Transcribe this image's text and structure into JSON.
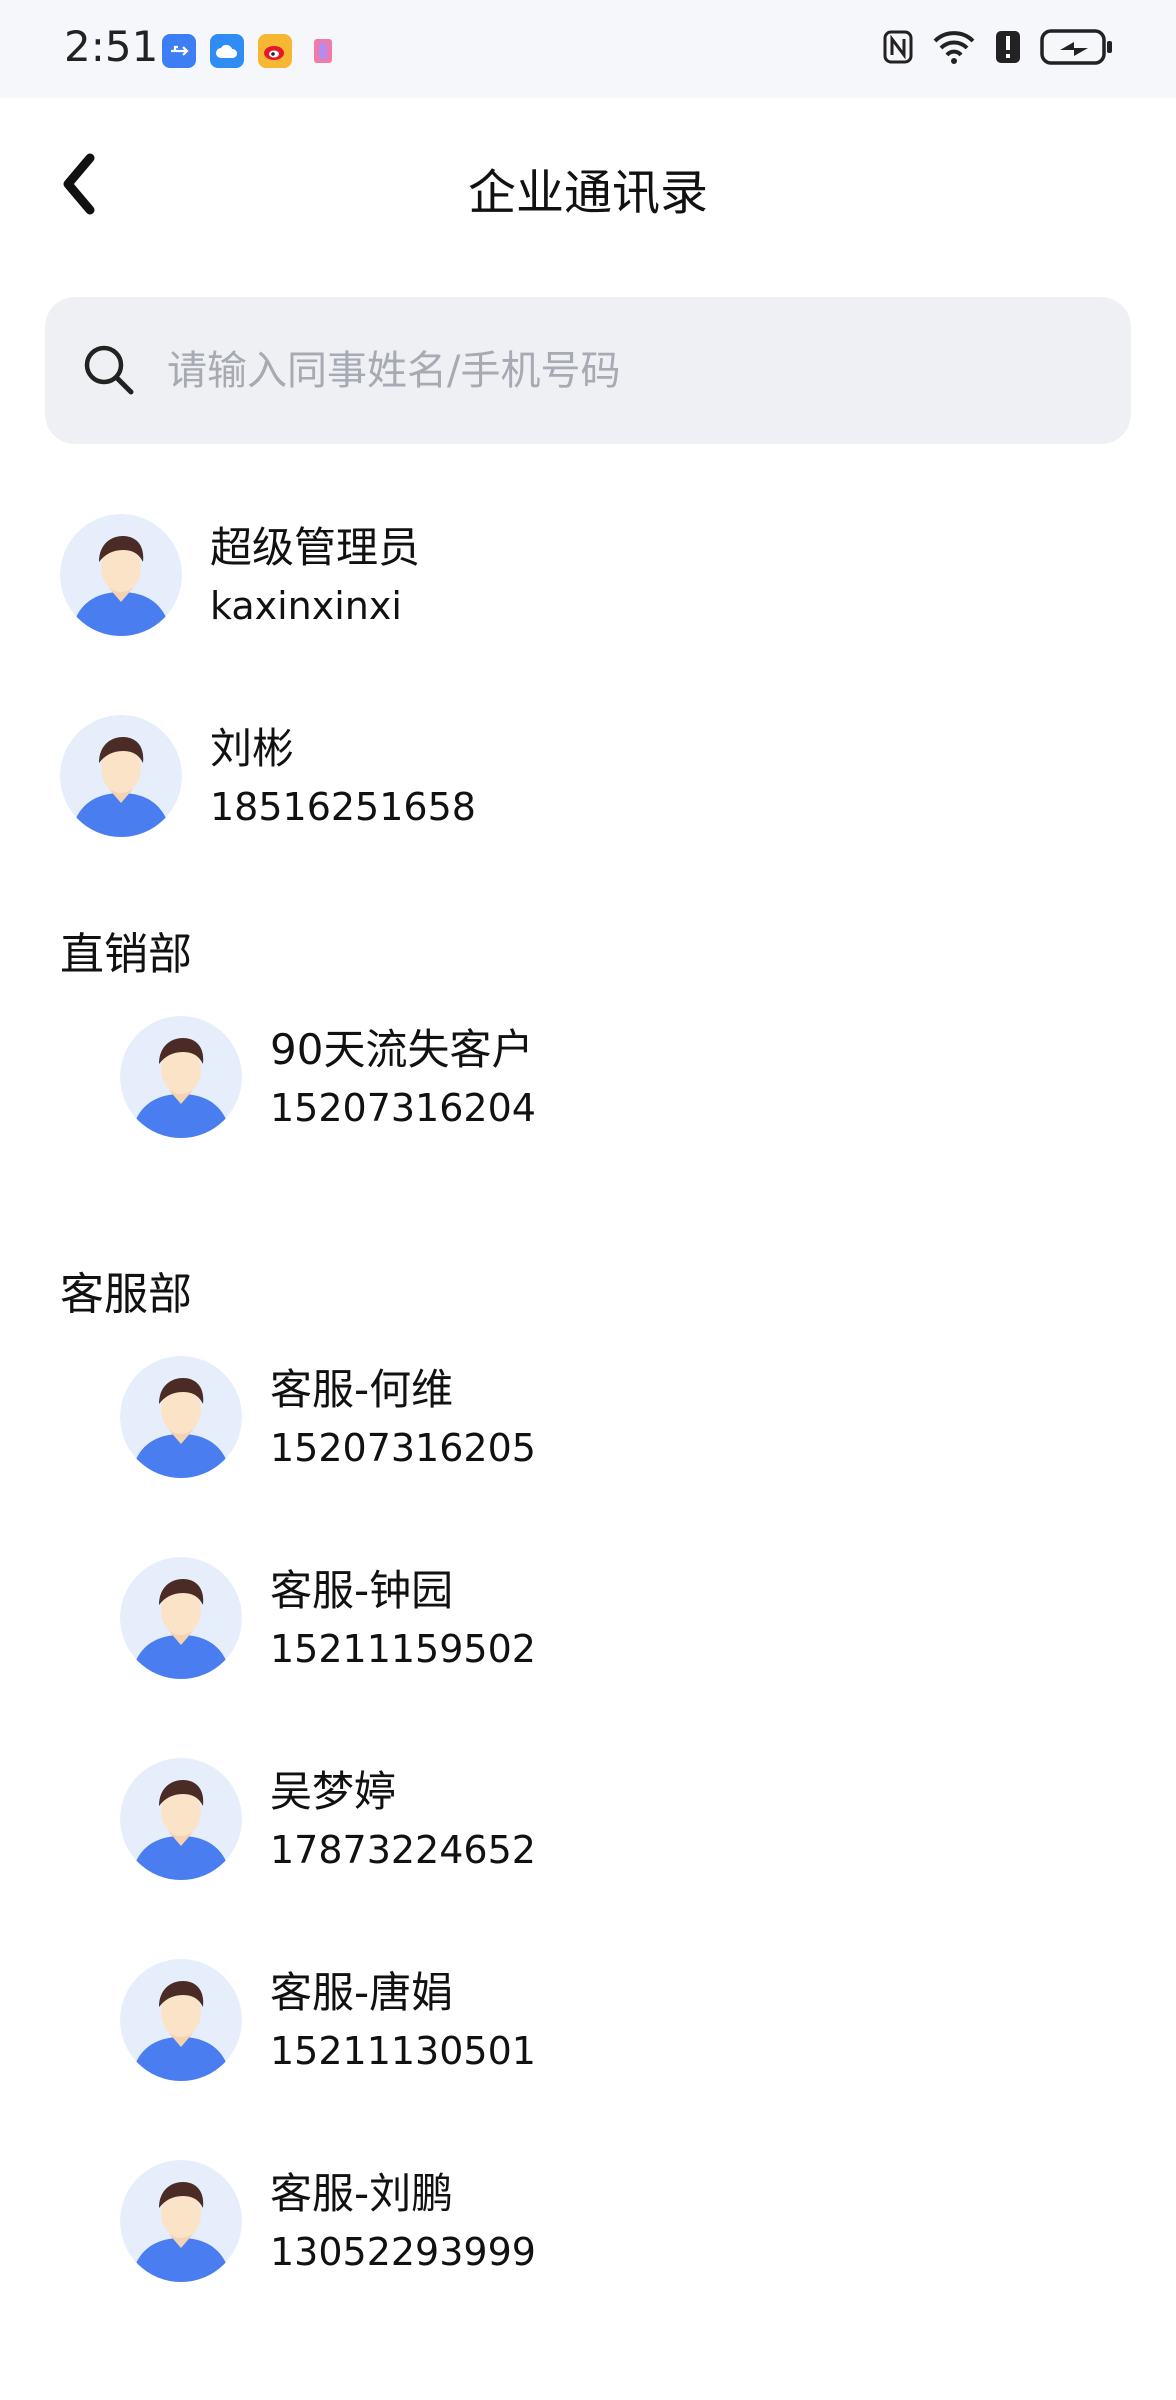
{
  "status_bar": {
    "time": "2:51",
    "left_icons": [
      "usb-icon",
      "cloud-icon",
      "weibo-icon",
      "app-icon"
    ],
    "right_icons": [
      "nfc-icon",
      "wifi-icon",
      "alert-icon",
      "battery-charging-icon"
    ]
  },
  "header": {
    "title": "企业通讯录",
    "back_icon": "chevron-left-icon"
  },
  "search": {
    "placeholder": "请输入同事姓名/手机号码",
    "value": ""
  },
  "contacts": [
    {
      "name": "超级管理员",
      "sub": "kaxinxinxi"
    },
    {
      "name": "刘彬",
      "sub": "18516251658"
    }
  ],
  "departments": [
    {
      "name": "直销部",
      "members": [
        {
          "name": "90天流失客户",
          "sub": "15207316204"
        }
      ]
    },
    {
      "name": "客服部",
      "members": [
        {
          "name": "客服-何维",
          "sub": "15207316205"
        },
        {
          "name": "客服-钟园",
          "sub": "15211159502"
        },
        {
          "name": "吴梦婷",
          "sub": "17873224652"
        },
        {
          "name": "客服-唐娟",
          "sub": "15211130501"
        },
        {
          "name": "客服-刘鹏",
          "sub": "13052293999"
        }
      ]
    }
  ],
  "colors": {
    "avatar_bg": "#e6edfb",
    "avatar_shirt": "#4a7ef0",
    "search_bg": "#eef0f4",
    "placeholder": "#a7aab2"
  }
}
